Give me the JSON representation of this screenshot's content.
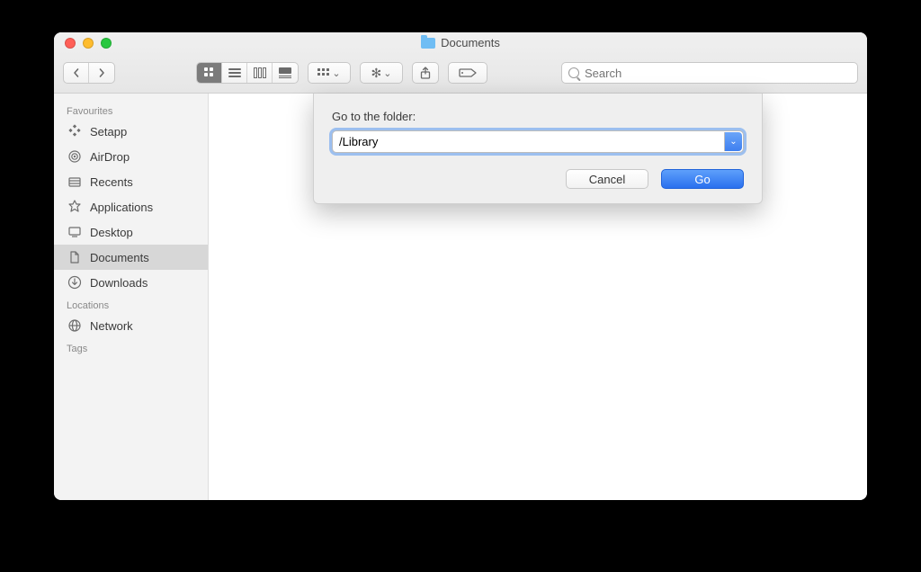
{
  "window": {
    "title": "Documents"
  },
  "toolbar": {
    "search_placeholder": "Search"
  },
  "sidebar": {
    "sections": {
      "favourites": {
        "title": "Favourites"
      },
      "locations": {
        "title": "Locations"
      },
      "tags": {
        "title": "Tags"
      }
    },
    "items": {
      "setapp": {
        "label": "Setapp"
      },
      "airdrop": {
        "label": "AirDrop"
      },
      "recents": {
        "label": "Recents"
      },
      "applications": {
        "label": "Applications"
      },
      "desktop": {
        "label": "Desktop"
      },
      "documents": {
        "label": "Documents"
      },
      "downloads": {
        "label": "Downloads"
      },
      "network": {
        "label": "Network"
      }
    }
  },
  "sheet": {
    "label": "Go to the folder:",
    "input_value": "/Library",
    "cancel_label": "Cancel",
    "go_label": "Go"
  }
}
